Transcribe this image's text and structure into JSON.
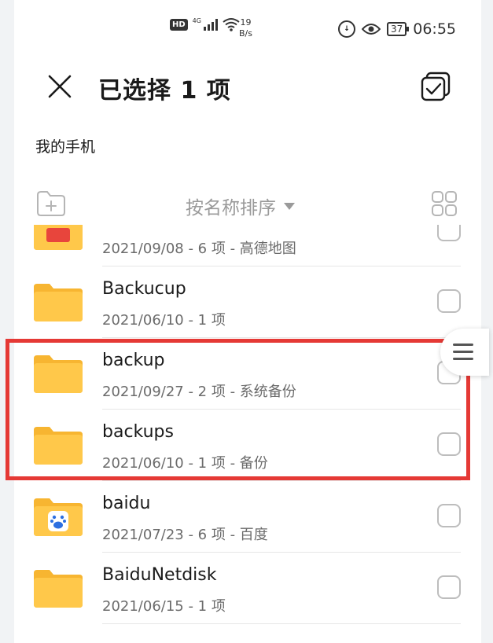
{
  "status_bar": {
    "network_badge": "HD",
    "network_type": "4G",
    "speed_value": "19",
    "speed_unit": "B/s",
    "battery": "37",
    "time": "06:55"
  },
  "header": {
    "title": "已选择 1 项"
  },
  "breadcrumb": "我的手机",
  "toolbar": {
    "sort_label": "按名称排序"
  },
  "files": [
    {
      "name": "",
      "meta": "2021/09/08 - 6 项 - 高德地图",
      "checked": false
    },
    {
      "name": "Backucup",
      "meta": "2021/06/10 - 1 项",
      "checked": false
    },
    {
      "name": "backup",
      "meta": "2021/09/27 - 2 项 - 系统备份",
      "checked": false
    },
    {
      "name": "backups",
      "meta": "2021/06/10 - 1 项 - 备份",
      "checked": false
    },
    {
      "name": "baidu",
      "meta": "2021/07/23 - 6 项 - 百度",
      "checked": false
    },
    {
      "name": "BaiduNetdisk",
      "meta": "2021/06/15 - 1 项",
      "checked": false
    }
  ],
  "colors": {
    "folder": "#FFC84A",
    "folder_tab": "#F7B531",
    "highlight": "#E53935"
  }
}
